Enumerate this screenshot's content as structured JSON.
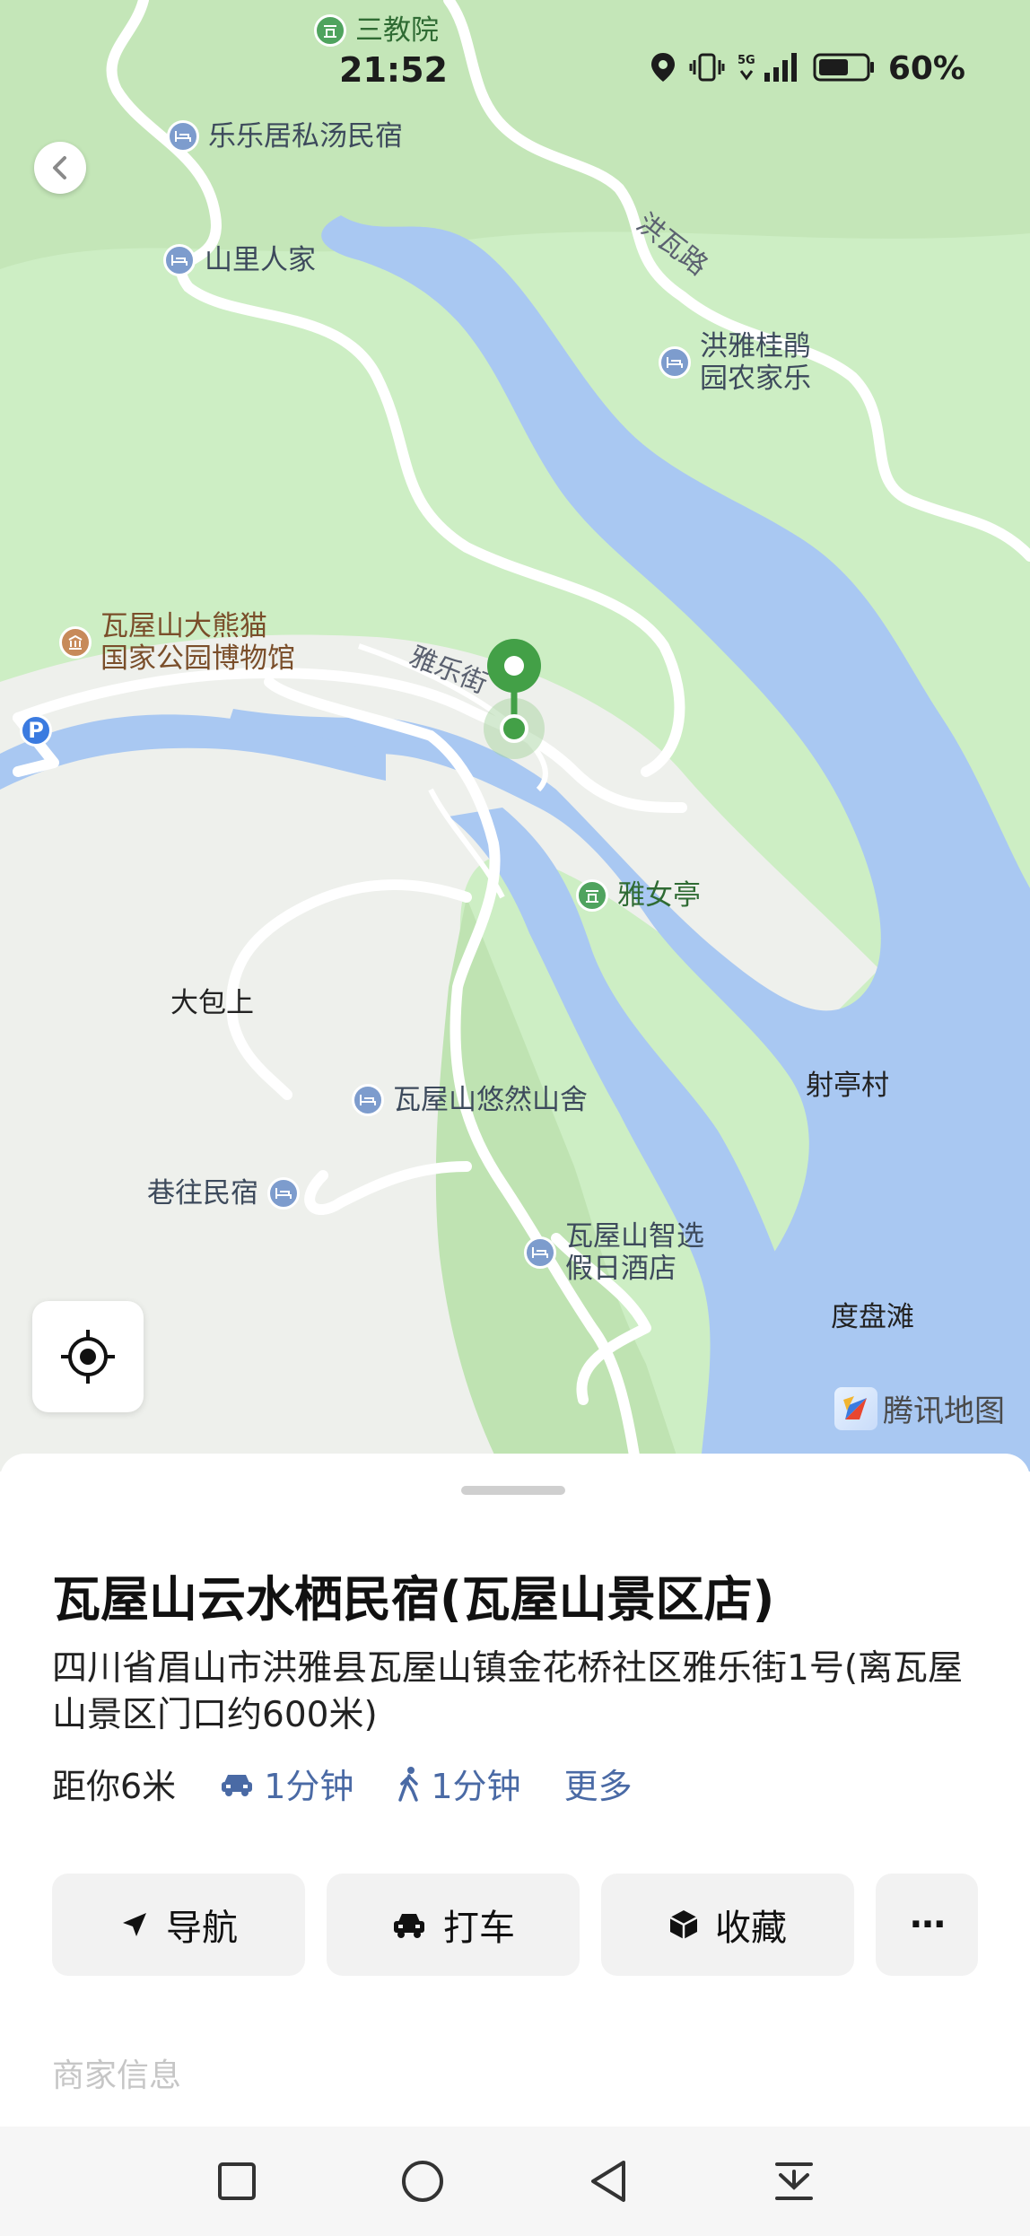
{
  "status_bar": {
    "time": "21:52",
    "battery_text": "60%",
    "icons": [
      "location-icon",
      "vibrate-icon",
      "5g-signal-icon",
      "battery-icon"
    ]
  },
  "map": {
    "pois": [
      {
        "name": "三教院",
        "type": "scenic"
      },
      {
        "name": "乐乐居私汤民宿",
        "type": "hotel"
      },
      {
        "name": "山里人家",
        "type": "hotel"
      },
      {
        "name": "洪雅桂鹃\n园农家乐",
        "type": "hotel"
      },
      {
        "name": "瓦屋山大熊猫\n国家公园博物馆",
        "type": "museum"
      },
      {
        "name": "雅女亭",
        "type": "scenic"
      },
      {
        "name": "瓦屋山悠然山舍",
        "type": "hotel"
      },
      {
        "name": "巷往民宿",
        "type": "hotel"
      },
      {
        "name": "瓦屋山智选\n假日酒店",
        "type": "hotel"
      },
      {
        "name": "P",
        "type": "parking"
      }
    ],
    "place_labels": [
      "大包上",
      "射亭村",
      "度盘滩"
    ],
    "road_labels": [
      "洪瓦路",
      "雅乐街"
    ],
    "brand": "腾讯地图"
  },
  "place": {
    "title": "瓦屋山云水栖民宿(瓦屋山景区店)",
    "address": "四川省眉山市洪雅县瓦屋山镇金花桥社区雅乐街1号(离瓦屋山景区门口约600米)",
    "distance": "距你6米",
    "drive_time": "1分钟",
    "walk_time": "1分钟",
    "more": "更多"
  },
  "actions": {
    "navigate": "导航",
    "taxi": "打车",
    "favorite": "收藏",
    "more": "···"
  },
  "faded_text": "商家信息",
  "colors": {
    "land": "#cdeec4",
    "water": "#a9c8f2",
    "road": "#ffffff",
    "accent_green": "#4caf50",
    "link_blue": "#4a6aa5"
  }
}
